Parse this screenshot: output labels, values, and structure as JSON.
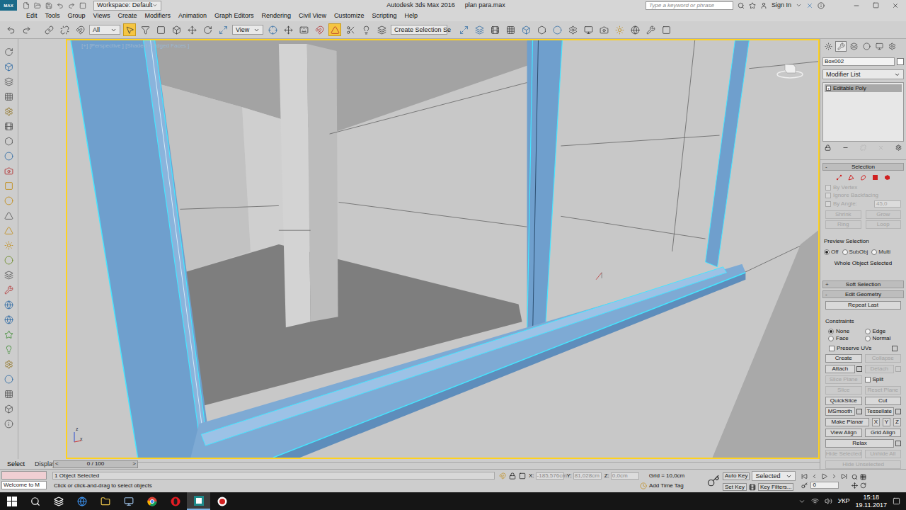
{
  "title_bar": {
    "app_logo": "MAX",
    "workspace": "Workspace: Default",
    "title": "Autodesk 3ds Max 2016",
    "file": "plan para.max",
    "search_placeholder": "Type a keyword or phrase",
    "sign_in": "Sign In"
  },
  "menu_bar": [
    "Edit",
    "Tools",
    "Group",
    "Views",
    "Create",
    "Modifiers",
    "Animation",
    "Graph Editors",
    "Rendering",
    "Civil View",
    "Customize",
    "Scripting",
    "Help"
  ],
  "main_toolbar": {
    "selection_filter": "All",
    "reference_coordinate_system": "View",
    "named_selection_set": "Create Selection Se",
    "select_object_active": true,
    "snap_toggle_active": true
  },
  "viewport": {
    "label": "[+] [Perspective ] [Shaded + Edged Faces ]",
    "active": true,
    "axis_labels": [
      "z",
      "x"
    ]
  },
  "command_panel": {
    "tabs": [
      {
        "kind": "create",
        "selected": false
      },
      {
        "kind": "modify",
        "selected": true
      },
      {
        "kind": "hierarchy",
        "selected": false
      },
      {
        "kind": "motion",
        "selected": false
      },
      {
        "kind": "display",
        "selected": false
      },
      {
        "kind": "utilities",
        "selected": false
      }
    ],
    "object_name": "Box002",
    "modifier_list": "Modifier List",
    "stack": [
      {
        "label": "Editable Poly",
        "sign": "+",
        "selected": true
      }
    ],
    "selection": {
      "title": "Selection",
      "levels": [
        {
          "kind": "vertex",
          "selected": false
        },
        {
          "kind": "edge",
          "selected": false
        },
        {
          "kind": "border",
          "selected": false
        },
        {
          "kind": "polygon",
          "selected": false
        },
        {
          "kind": "element",
          "selected": false
        }
      ],
      "checkboxes": [
        {
          "label": "By Vertex",
          "checked": false,
          "disabled": true
        },
        {
          "label": "Ignore Backfacing",
          "checked": false,
          "disabled": true
        }
      ],
      "by_angle": {
        "label": "By Angle:",
        "checked": false,
        "disabled": true,
        "value": "45,0"
      },
      "button_rows": [
        [
          {
            "label": "Shrink",
            "disabled": true
          },
          {
            "label": "Grow",
            "disabled": true
          }
        ],
        [
          {
            "label": "Ring",
            "disabled": true
          },
          {
            "label": "Loop",
            "disabled": true
          }
        ]
      ],
      "preview_title": "Preview Selection",
      "preview_options": [
        {
          "label": "Off",
          "selected": true
        },
        {
          "label": "SubObj",
          "selected": false
        },
        {
          "label": "Multi",
          "selected": false
        }
      ],
      "status": "Whole Object Selected"
    },
    "rollouts": [
      {
        "label": "Soft Selection",
        "sign": "+",
        "expanded": false
      },
      {
        "label": "Edit Geometry",
        "sign": "-",
        "expanded": true
      }
    ],
    "edit_geometry": {
      "repeat_last": "Repeat Last",
      "constraints_title": "Constraints",
      "constraints": [
        {
          "label": "None",
          "selected": true
        },
        {
          "label": "Edge",
          "selected": false
        },
        {
          "label": "Face",
          "selected": false
        },
        {
          "label": "Normal",
          "selected": false
        }
      ],
      "preserve_uvs": {
        "label": "Preserve UVs",
        "checked": false
      },
      "rows": [
        [
          {
            "kind": "button",
            "label": "Create",
            "disabled": false,
            "settings": false
          },
          {
            "kind": "button",
            "label": "Collapse",
            "disabled": true,
            "settings": false
          }
        ],
        [
          {
            "kind": "button",
            "label": "Attach",
            "disabled": false,
            "settings": true
          },
          {
            "kind": "button",
            "label": "Detach",
            "disabled": true,
            "settings": true
          }
        ],
        [
          {
            "kind": "button",
            "label": "Slice Plane",
            "disabled": true,
            "settings": false
          },
          {
            "kind": "checkbox",
            "label": "Split",
            "disabled": false,
            "checked": false
          }
        ],
        [
          {
            "kind": "button",
            "label": "Slice",
            "disabled": true,
            "settings": false
          },
          {
            "kind": "button",
            "label": "Reset Plane",
            "disabled": true,
            "settings": false
          }
        ],
        [
          {
            "kind": "button",
            "label": "QuickSlice",
            "disabled": false,
            "settings": false
          },
          {
            "kind": "button",
            "label": "Cut",
            "disabled": false,
            "settings": false
          }
        ],
        [
          {
            "kind": "button",
            "label": "MSmooth",
            "disabled": false,
            "settings": true
          },
          {
            "kind": "button",
            "label": "Tessellate",
            "disabled": false,
            "settings": true
          }
        ],
        [
          {
            "kind": "button",
            "label": "Make Planar",
            "disabled": false,
            "settings": false
          },
          {
            "kind": "axis",
            "label": "X",
            "disabled": false
          },
          {
            "kind": "axis",
            "label": "Y",
            "disabled": false
          },
          {
            "kind": "axis",
            "label": "Z",
            "disabled": false
          }
        ],
        [
          {
            "kind": "button",
            "label": "View Align",
            "disabled": false,
            "settings": false
          },
          {
            "kind": "button",
            "label": "Grid Align",
            "disabled": false,
            "settings": false
          }
        ],
        [
          {
            "kind": "button",
            "label": "Relax",
            "disabled": false,
            "settings": true
          }
        ],
        [
          {
            "kind": "button",
            "label": "Hide Selected",
            "disabled": true,
            "settings": false
          },
          {
            "kind": "button",
            "label": "Unhide All",
            "disabled": true,
            "settings": false
          }
        ],
        [
          {
            "kind": "button",
            "label": "Hide Unselected",
            "disabled": true,
            "settings": false
          }
        ]
      ]
    }
  },
  "bottom_tabs": [
    {
      "label": "Select",
      "selected": true
    },
    {
      "label": "Display",
      "selected": false
    }
  ],
  "time_slider": {
    "prev": "<",
    "position": "0 / 100",
    "next": ">"
  },
  "maxscript": {
    "output": "Welcome to M"
  },
  "status_bar": {
    "selected": "1 Object Selected",
    "prompt": "Click or click-and-drag to select objects",
    "coordinates": [
      {
        "label": "X:",
        "value": "-185,576cm"
      },
      {
        "label": "Y:",
        "value": "81,028cm"
      },
      {
        "label": "Z:",
        "value": "0,0cm"
      }
    ],
    "grid": "Grid = 10,0cm",
    "add_time_tag": "Add Time Tag"
  },
  "animation": {
    "auto_key": "Auto Key",
    "auto_key_on": false,
    "key_mode": "Selected",
    "set_key": "Set Key",
    "key_filters": "Key Filters...",
    "frame": "0"
  },
  "taskbar": {
    "apps": [
      {
        "kind": "start",
        "active": false
      },
      {
        "kind": "search",
        "active": false
      },
      {
        "kind": "task-view",
        "active": false
      },
      {
        "kind": "edge",
        "active": false
      },
      {
        "kind": "explorer",
        "active": false
      },
      {
        "kind": "monitor",
        "active": false
      },
      {
        "kind": "chrome",
        "active": false
      },
      {
        "kind": "opera",
        "active": false
      },
      {
        "kind": "max",
        "active": true
      },
      {
        "kind": "recorder",
        "active": false
      }
    ],
    "language": "УКР",
    "time": "15:18",
    "date": "19.11.2017"
  }
}
